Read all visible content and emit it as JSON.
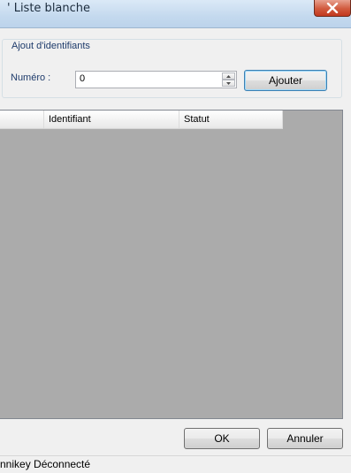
{
  "window": {
    "title": "' Liste blanche"
  },
  "group": {
    "legend": "Ajout d'identifiants",
    "number_label": "Numéro :",
    "number_value": "0",
    "add_label": "Ajouter"
  },
  "table": {
    "columns": [
      "",
      "Identifiant",
      "Statut"
    ]
  },
  "buttons": {
    "ok_label": "OK",
    "cancel_label": "Annuler"
  },
  "status": {
    "text": "nnikey Déconnecté"
  }
}
